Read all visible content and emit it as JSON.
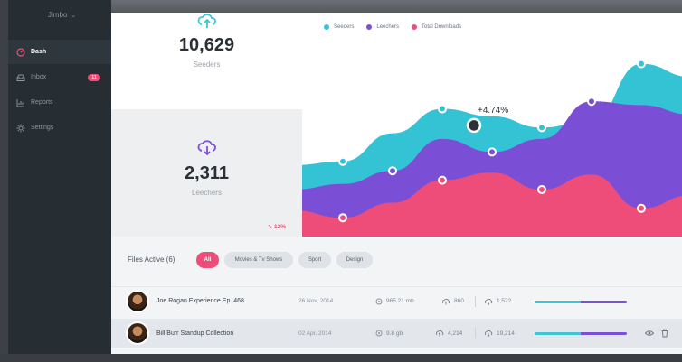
{
  "app": {
    "brand": "Jimbo"
  },
  "sidebar": {
    "items": [
      {
        "label": "Dash",
        "icon": "dashboard-icon",
        "active": true
      },
      {
        "label": "Inbox",
        "icon": "inbox-icon",
        "badge": "11"
      },
      {
        "label": "Reports",
        "icon": "reports-icon"
      },
      {
        "label": "Settings",
        "icon": "settings-gear-icon"
      }
    ]
  },
  "stats": {
    "seeders": {
      "value": "10,629",
      "label": "Seeders",
      "icon": "cloud-upload-icon",
      "color": "#3ec6d7"
    },
    "leechers": {
      "value": "2,311",
      "label": "Leechers",
      "icon": "cloud-download-icon",
      "color": "#7c4fd9",
      "trend": "12%"
    }
  },
  "chart": {
    "legend": [
      {
        "label": "Seeders",
        "color": "#34c3d5"
      },
      {
        "label": "Leechers",
        "color": "#7b4ed6"
      },
      {
        "label": "Total Downloads",
        "color": "#ee4d7a"
      }
    ],
    "annotation": "+4.74%"
  },
  "chart_data": {
    "type": "area",
    "series": [
      {
        "name": "Seeders",
        "values": [
          38,
          40,
          55,
          68,
          64,
          58,
          62,
          92,
          85
        ]
      },
      {
        "name": "Leechers",
        "values": [
          25,
          28,
          35,
          52,
          45,
          52,
          72,
          70,
          65
        ]
      },
      {
        "name": "Total Downloads",
        "values": [
          14,
          10,
          18,
          30,
          34,
          25,
          33,
          15,
          22
        ]
      }
    ],
    "annotation": "+4.74%",
    "grid": false,
    "legend_position": "top-left"
  },
  "files": {
    "title": "Files Active (6)",
    "filters": [
      "All",
      "Movies & Tv Shows",
      "Sport",
      "Design"
    ],
    "rows": [
      {
        "name": "Joe Rogan Experience Ep. 468",
        "date": "26 Nov, 2014",
        "size": "965.21 mb",
        "seeds": "860",
        "peers": "1,522",
        "progress_seed": 0.5,
        "progress_total": 1.0
      },
      {
        "name": "Bill Burr Standup Collection",
        "date": "02 Apr, 2014",
        "size": "9.8 gb",
        "seeds": "4,214",
        "peers": "19,214",
        "progress_seed": 0.5,
        "progress_total": 1.0
      }
    ]
  }
}
